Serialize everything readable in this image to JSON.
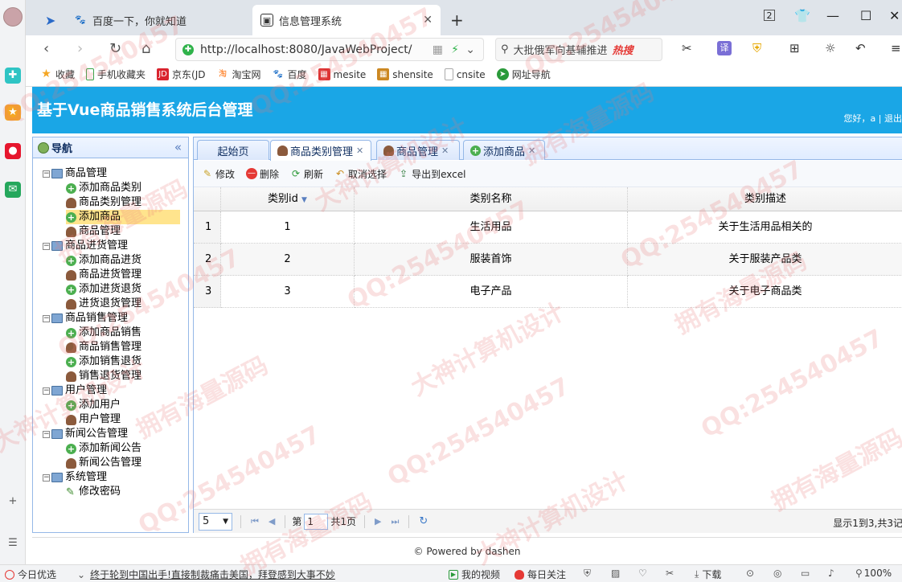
{
  "browser": {
    "tabs": [
      {
        "label": "百度一下，你就知道",
        "icon": "baidu-paw-icon"
      },
      {
        "label": "信息管理系统",
        "icon": "page-icon"
      }
    ],
    "url": "http://localhost:8080/JavaWebProject/",
    "search_text": "大批俄军向基辅推进",
    "search_hot": "热搜",
    "tab_count": "2",
    "bookmarks": [
      {
        "label": "收藏",
        "color": "#f5a623"
      },
      {
        "label": "手机收藏夹",
        "color": "#3aa54a"
      },
      {
        "label": "京东(JD",
        "color": "#d9232e"
      },
      {
        "label": "淘宝网",
        "color": "#ff6a00"
      },
      {
        "label": "百度",
        "color": "#2d64d8"
      },
      {
        "label": "mesite",
        "color": "#d33"
      },
      {
        "label": "shensite",
        "color": "#c82"
      },
      {
        "label": "cnsite",
        "color": "#aaa"
      },
      {
        "label": "网址导航",
        "color": "#2a9a3a"
      }
    ]
  },
  "app": {
    "title": "基于Vue商品销售系统后台管理",
    "user_bar": "您好，a | 退出"
  },
  "nav": {
    "title": "导航",
    "tree": [
      {
        "label": "商品管理",
        "type": "group",
        "children": [
          {
            "label": "添加商品类别",
            "icon": "add"
          },
          {
            "label": "商品类别管理",
            "icon": "user"
          },
          {
            "label": "添加商品",
            "icon": "add",
            "selected": true
          },
          {
            "label": "商品管理",
            "icon": "user"
          }
        ]
      },
      {
        "label": "商品进货管理",
        "type": "group",
        "children": [
          {
            "label": "添加商品进货",
            "icon": "add"
          },
          {
            "label": "商品进货管理",
            "icon": "user"
          },
          {
            "label": "添加进货退货",
            "icon": "add"
          },
          {
            "label": "进货退货管理",
            "icon": "user"
          }
        ]
      },
      {
        "label": "商品销售管理",
        "type": "group",
        "children": [
          {
            "label": "添加商品销售",
            "icon": "add"
          },
          {
            "label": "商品销售管理",
            "icon": "user"
          },
          {
            "label": "添加销售退货",
            "icon": "add"
          },
          {
            "label": "销售退货管理",
            "icon": "user"
          }
        ]
      },
      {
        "label": "用户管理",
        "type": "group",
        "children": [
          {
            "label": "添加用户",
            "icon": "add"
          },
          {
            "label": "用户管理",
            "icon": "user"
          }
        ]
      },
      {
        "label": "新闻公告管理",
        "type": "group",
        "children": [
          {
            "label": "添加新闻公告",
            "icon": "add"
          },
          {
            "label": "新闻公告管理",
            "icon": "user"
          }
        ]
      },
      {
        "label": "系统管理",
        "type": "group",
        "children": [
          {
            "label": "修改密码",
            "icon": "pen"
          }
        ]
      }
    ]
  },
  "main": {
    "tabs": [
      {
        "label": "起始页",
        "closable": false
      },
      {
        "label": "商品类别管理",
        "closable": true,
        "active": true
      },
      {
        "label": "商品管理",
        "closable": true
      },
      {
        "label": "添加商品",
        "closable": true
      }
    ],
    "toolbar": {
      "edit": "修改",
      "delete": "删除",
      "refresh": "刷新",
      "unselect": "取消选择",
      "export": "导出到excel"
    },
    "grid": {
      "columns": [
        "类别id",
        "类别名称",
        "类别描述"
      ],
      "rows": [
        {
          "num": "1",
          "id": "1",
          "name": "生活用品",
          "desc": "关于生活用品相关的"
        },
        {
          "num": "2",
          "id": "2",
          "name": "服装首饰",
          "desc": "关于服装产品类"
        },
        {
          "num": "3",
          "id": "3",
          "name": "电子产品",
          "desc": "关于电子商品类"
        }
      ]
    },
    "pager": {
      "page_size": "5",
      "page_prefix": "第",
      "page_value": "1",
      "page_total": "共1页",
      "info": "显示1到3,共3记"
    }
  },
  "footer": {
    "text": "© Powered by dashen"
  },
  "statusbar": {
    "today": "今日优选",
    "news": "终于轮到中国出手!直接制裁痛击美国，拜登感到大事不妙",
    "video": "我的视频",
    "follow": "每日关注",
    "download": "下载",
    "zoom": "100%"
  },
  "watermark": {
    "qq": "QQ:254540457",
    "a": "大神计算机设计",
    "b": "拥有海量源码"
  }
}
